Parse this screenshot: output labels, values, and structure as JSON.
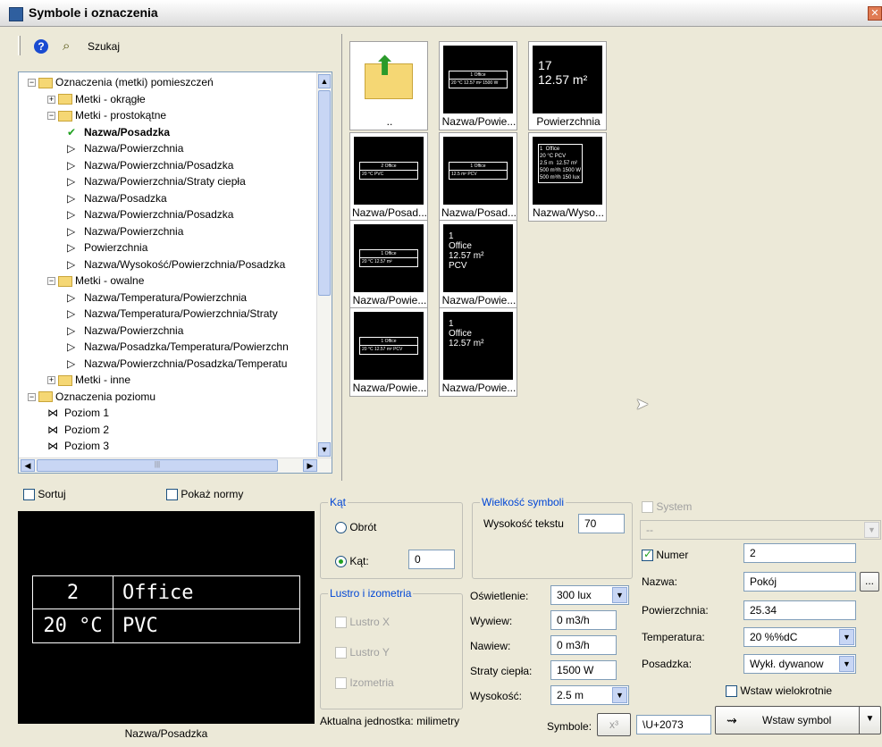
{
  "window": {
    "title": "Symbole i oznaczenia",
    "close_icon": "close-icon"
  },
  "toolbar": {
    "search_label": "Szukaj",
    "help_icon": "help-icon",
    "search_icon": "binoculars-icon"
  },
  "tree": {
    "items": [
      {
        "label": "Oznaczenia (metki) pomieszczeń",
        "kind": "folder",
        "exp": "−"
      },
      {
        "label": "Metki - okrągłe",
        "kind": "folder",
        "exp": "+"
      },
      {
        "label": "Metki - prostokątne",
        "kind": "folder",
        "exp": "−"
      },
      {
        "label": "Nazwa/Posadzka",
        "kind": "selected"
      },
      {
        "label": "Nazwa/Powierzchnia",
        "kind": "tag"
      },
      {
        "label": "Nazwa/Powierzchnia/Posadzka",
        "kind": "tag"
      },
      {
        "label": "Nazwa/Powierzchnia/Straty ciepła",
        "kind": "tag"
      },
      {
        "label": "Nazwa/Posadzka",
        "kind": "tag"
      },
      {
        "label": "Nazwa/Powierzchnia/Posadzka",
        "kind": "tag"
      },
      {
        "label": "Nazwa/Powierzchnia",
        "kind": "tag"
      },
      {
        "label": "Powierzchnia",
        "kind": "tag"
      },
      {
        "label": "Nazwa/Wysokość/Powierzchnia/Posadzka",
        "kind": "tag"
      },
      {
        "label": "Metki - owalne",
        "kind": "folder",
        "exp": "−"
      },
      {
        "label": "Nazwa/Temperatura/Powierzchnia",
        "kind": "tag"
      },
      {
        "label": "Nazwa/Temperatura/Powierzchnia/Straty",
        "kind": "tag"
      },
      {
        "label": "Nazwa/Powierzchnia",
        "kind": "tag"
      },
      {
        "label": "Nazwa/Posadzka/Temperatura/Powierzchn",
        "kind": "tag"
      },
      {
        "label": "Nazwa/Powierzchnia/Posadzka/Temperatu",
        "kind": "tag"
      },
      {
        "label": "Metki - inne",
        "kind": "folder",
        "exp": "+"
      },
      {
        "label": "Oznaczenia poziomu",
        "kind": "folder",
        "exp": "−"
      },
      {
        "label": "Poziom 1",
        "kind": "level"
      },
      {
        "label": "Poziom 2",
        "kind": "level"
      },
      {
        "label": "Poziom 3",
        "kind": "level"
      }
    ]
  },
  "gallery": {
    "items": [
      {
        "caption": "..",
        "kind": "up"
      },
      {
        "caption": "Nazwa/Powie...",
        "kind": "mini",
        "r1": "1   Office",
        "r2": "20 °C 12.57 m²  1500 W"
      },
      {
        "caption": "Powierzchnia",
        "kind": "text",
        "text": "17\n12.57 m²"
      },
      {
        "caption": "Nazwa/Posad...",
        "kind": "mini",
        "r1": "2   Office",
        "r2": "20 °C PVC"
      },
      {
        "caption": "Nazwa/Posad...",
        "kind": "mini",
        "r1": "1   Office",
        "r2": "12.5 m² PCV"
      },
      {
        "caption": "Nazwa/Wyso...",
        "kind": "text",
        "text": "1  Office\n20 °C PCV\n2.5 m  12.57 m²\n500 m³/h 1500 W\n500 m³/h 150 lux"
      },
      {
        "caption": "Nazwa/Powie...",
        "kind": "mini",
        "r1": "1   Office",
        "r2": "20 °C 12.57 m²"
      },
      {
        "caption": "Nazwa/Powie...",
        "kind": "text",
        "text": "1\nOffice\n12.57 m²\nPCV"
      },
      {
        "caption": "Nazwa/Powie...",
        "kind": "mini",
        "r1": "1   Office",
        "r2": "20 °C 12.57 m²  PCV"
      },
      {
        "caption": "Nazwa/Powie...",
        "kind": "text",
        "text": "1\nOffice\n12.57 m²"
      }
    ]
  },
  "options": {
    "sort_label": "Sortuj",
    "show_norms_label": "Pokaż normy"
  },
  "preview": {
    "num": "2",
    "name": "Office",
    "temp": "20 °C",
    "floor": "PVC",
    "caption": "Nazwa/Posadzka"
  },
  "angle": {
    "legend": "Kąt",
    "rotation_label": "Obrót",
    "angle_label": "Kąt:",
    "angle_value": "0"
  },
  "size": {
    "legend": "Wielkość symboli",
    "text_height_label": "Wysokość tekstu",
    "text_height_value": "70"
  },
  "mirror": {
    "legend": "Lustro i izometria",
    "mirror_x": "Lustro X",
    "mirror_y": "Lustro Y",
    "isometry": "Izometria"
  },
  "params": {
    "lighting_label": "Oświetlenie:",
    "lighting_value": "300 lux",
    "exhaust_label": "Wywiew:",
    "exhaust_value": "0 m3/h",
    "supply_label": "Nawiew:",
    "supply_value": "0 m3/h",
    "heatloss_label": "Straty ciepła:",
    "heatloss_value": "1500 W",
    "height_label": "Wysokość:",
    "height_value": "2.5 m"
  },
  "right": {
    "system_label": "System",
    "system_value": "--",
    "number_label": "Numer",
    "number_value": "2",
    "name_label": "Nazwa:",
    "name_value": "Pokój",
    "browse_label": "...",
    "area_label": "Powierzchnia:",
    "area_value": "25.34",
    "temp_label": "Temperatura:",
    "temp_value": "20 %%dC",
    "floor_label": "Posadzka:",
    "floor_value": "Wykł. dywanow",
    "multi_label": "Wstaw wielokrotnie",
    "insert_label": "Wstaw symbol"
  },
  "footer": {
    "unit_label": "Aktualna jednostka: milimetry",
    "symbols_label": "Symbole:",
    "symbols_glyph": "x³",
    "symbols_value": "\\U+2073"
  }
}
